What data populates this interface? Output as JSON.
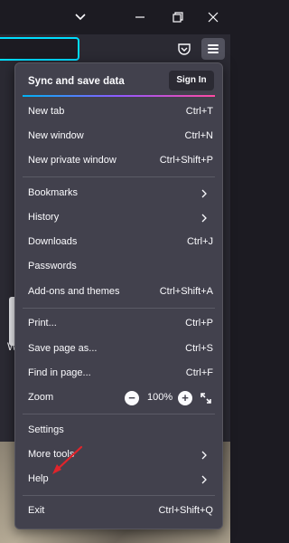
{
  "header": {
    "sync_title": "Sync and save data",
    "sign_in_label": "Sign In"
  },
  "menu": {
    "new_tab": {
      "label": "New tab",
      "shortcut": "Ctrl+T"
    },
    "new_window": {
      "label": "New window",
      "shortcut": "Ctrl+N"
    },
    "new_private_window": {
      "label": "New private window",
      "shortcut": "Ctrl+Shift+P"
    },
    "bookmarks": {
      "label": "Bookmarks"
    },
    "history": {
      "label": "History"
    },
    "downloads": {
      "label": "Downloads",
      "shortcut": "Ctrl+J"
    },
    "passwords": {
      "label": "Passwords"
    },
    "addons": {
      "label": "Add-ons and themes",
      "shortcut": "Ctrl+Shift+A"
    },
    "print": {
      "label": "Print...",
      "shortcut": "Ctrl+P"
    },
    "save_page": {
      "label": "Save page as...",
      "shortcut": "Ctrl+S"
    },
    "find_in_page": {
      "label": "Find in page...",
      "shortcut": "Ctrl+F"
    },
    "zoom": {
      "label": "Zoom",
      "minus": "−",
      "value": "100%",
      "plus": "+"
    },
    "settings": {
      "label": "Settings"
    },
    "more_tools": {
      "label": "More tools"
    },
    "help": {
      "label": "Help"
    },
    "exit": {
      "label": "Exit",
      "shortcut": "Ctrl+Shift+Q"
    }
  },
  "page": {
    "partial_letter": "W"
  },
  "colors": {
    "menu_bg": "#42414d",
    "accent_focus": "#00ddff",
    "annotation_arrow": "#e0242b"
  }
}
